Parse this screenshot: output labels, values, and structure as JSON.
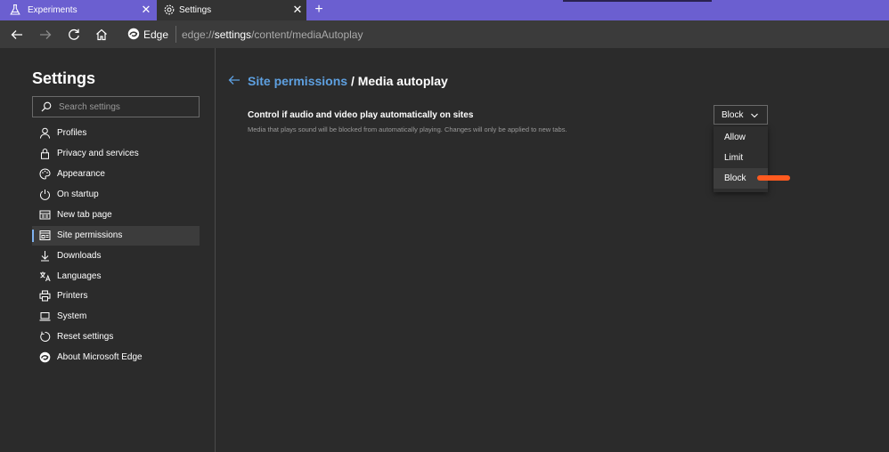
{
  "tabs": [
    {
      "label": "Experiments",
      "icon": "flask-icon",
      "active": false
    },
    {
      "label": "Settings",
      "icon": "gear-icon",
      "active": true
    }
  ],
  "toolbar": {
    "brand": "Edge",
    "url_prefix": "edge://",
    "url_host": "settings",
    "url_path": "/content/mediaAutoplay"
  },
  "sidebar": {
    "title": "Settings",
    "search_placeholder": "Search settings",
    "items": [
      {
        "label": "Profiles",
        "icon": "person-icon"
      },
      {
        "label": "Privacy and services",
        "icon": "lock-icon"
      },
      {
        "label": "Appearance",
        "icon": "palette-icon"
      },
      {
        "label": "On startup",
        "icon": "power-icon"
      },
      {
        "label": "New tab page",
        "icon": "grid-icon"
      },
      {
        "label": "Site permissions",
        "icon": "site-permissions-icon",
        "active": true
      },
      {
        "label": "Downloads",
        "icon": "download-icon"
      },
      {
        "label": "Languages",
        "icon": "languages-icon"
      },
      {
        "label": "Printers",
        "icon": "printer-icon"
      },
      {
        "label": "System",
        "icon": "laptop-icon"
      },
      {
        "label": "Reset settings",
        "icon": "reset-icon"
      },
      {
        "label": "About Microsoft Edge",
        "icon": "edge-icon"
      }
    ]
  },
  "main": {
    "breadcrumb_link": "Site permissions",
    "breadcrumb_current": "/ Media autoplay",
    "setting_title": "Control if audio and video play automatically on sites",
    "setting_description": "Media that plays sound will be blocked from automatically playing. Changes will only be applied to new tabs.",
    "select_value": "Block",
    "options": [
      "Allow",
      "Limit",
      "Block"
    ],
    "selected_option": "Block"
  },
  "colors": {
    "tabbar": "#6b5fd0",
    "link": "#5ea0e0",
    "annotation": "#ff5a1f"
  }
}
